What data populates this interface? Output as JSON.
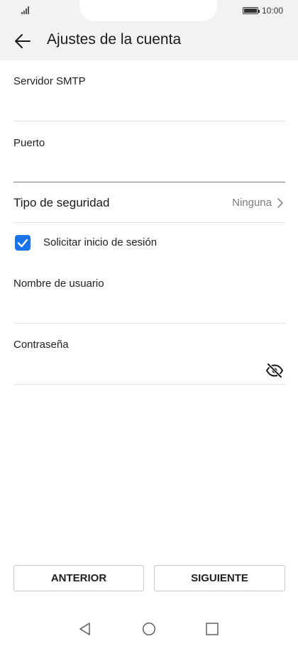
{
  "status": {
    "time": "10:00"
  },
  "header": {
    "title": "Ajustes de la cuenta"
  },
  "form": {
    "smtp_label": "Servidor SMTP",
    "smtp_value": "",
    "port_label": "Puerto",
    "port_value": "",
    "security_label": "Tipo de seguridad",
    "security_value": "Ninguna",
    "login_checkbox_label": "Solicitar inicio de sesión",
    "login_checked": true,
    "username_label": "Nombre de usuario",
    "username_value": "",
    "password_label": "Contraseña",
    "password_value": ""
  },
  "buttons": {
    "previous": "ANTERIOR",
    "next": "SIGUIENTE"
  },
  "icons": {
    "back": "arrow-left-icon",
    "chevron": "chevron-right-icon",
    "checkbox": "checkmark-icon",
    "eye": "eye-off-icon",
    "nav_back": "triangle-back-icon",
    "nav_home": "circle-home-icon",
    "nav_recent": "square-recent-icon"
  },
  "colors": {
    "accent": "#1a73e8",
    "header_bg": "#f2f2f2"
  }
}
